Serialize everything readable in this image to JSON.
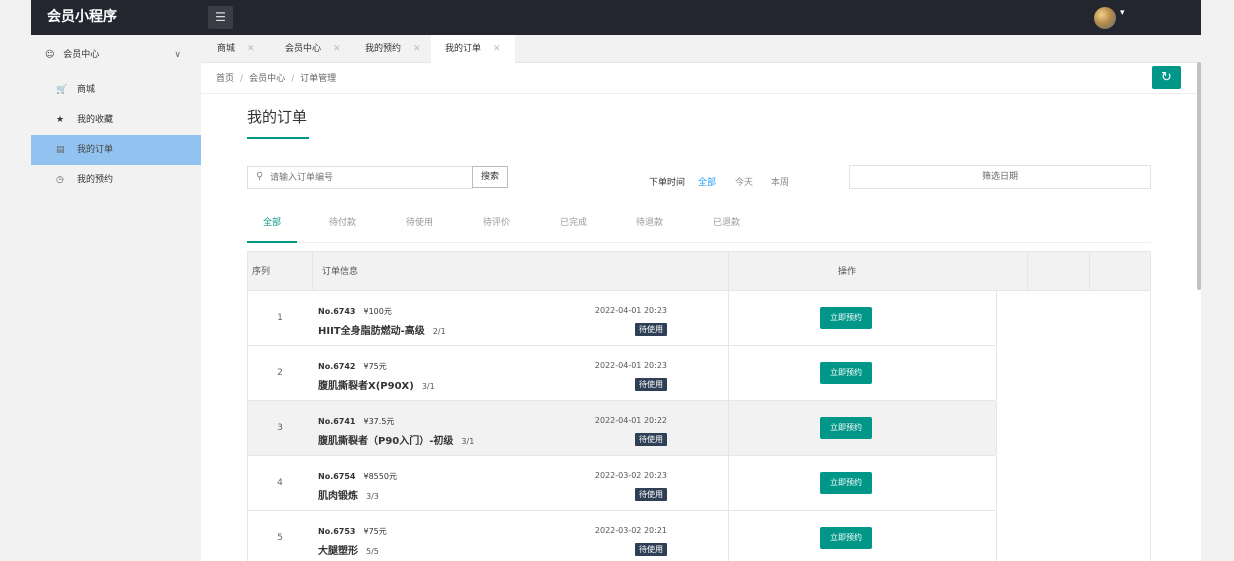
{
  "app": {
    "title": "会员小程序",
    "menu_icon": "hamburger-icon",
    "avatar_icon": "avatar-image",
    "caret": "▾"
  },
  "sidebar": {
    "group": {
      "label": "会员中心",
      "icon": "user-icon"
    },
    "items": [
      {
        "label": "商城",
        "icon": "cart-icon"
      },
      {
        "label": "我的收藏",
        "icon": "star-icon"
      },
      {
        "label": "我的订单",
        "icon": "order-icon"
      },
      {
        "label": "我的预约",
        "icon": "clock-icon"
      }
    ]
  },
  "tabs": [
    {
      "label": "商城"
    },
    {
      "label": "会员中心"
    },
    {
      "label": "我的预约"
    },
    {
      "label": "我的订单"
    }
  ],
  "breadcrumb": {
    "items": [
      "首页",
      "会员中心",
      "订单管理"
    ],
    "sep": "/"
  },
  "page": {
    "title": "我的订单"
  },
  "search": {
    "placeholder": "请输入订单编号",
    "button": "搜索"
  },
  "time_filter": {
    "label": "下单时间",
    "options": [
      "全部",
      "今天",
      "本周"
    ],
    "selected": "全部"
  },
  "date_filter": {
    "placeholder": "筛选日期"
  },
  "status_tabs": [
    "全部",
    "待付款",
    "待使用",
    "待评价",
    "已完成",
    "待退款",
    "已退款"
  ],
  "table": {
    "headers": {
      "index": "序列",
      "info": "订单信息",
      "action": "操作"
    },
    "rows": [
      {
        "index": "1",
        "no": "No.6743",
        "price": "¥100元",
        "name": "HIIT全身脂肪燃动-高级",
        "qty": "2/1",
        "time": "2022-04-01 20:23",
        "status": "待使用",
        "action": "立即预约"
      },
      {
        "index": "2",
        "no": "No.6742",
        "price": "¥75元",
        "name": "腹肌撕裂者X(P90X)",
        "qty": "3/1",
        "time": "2022-04-01 20:23",
        "status": "待使用",
        "action": "立即预约"
      },
      {
        "index": "3",
        "no": "No.6741",
        "price": "¥37.5元",
        "name": "腹肌撕裂者（P90入门）-初级",
        "qty": "3/1",
        "time": "2022-04-01 20:22",
        "status": "待使用",
        "action": "立即预约"
      },
      {
        "index": "4",
        "no": "No.6754",
        "price": "¥8550元",
        "name": "肌肉锻炼",
        "qty": "3/3",
        "time": "2022-03-02 20:23",
        "status": "待使用",
        "action": "立即预约"
      },
      {
        "index": "5",
        "no": "No.6753",
        "price": "¥75元",
        "name": "大腿塑形",
        "qty": "5/5",
        "time": "2022-03-02 20:21",
        "status": "待使用",
        "action": "立即预约"
      }
    ]
  }
}
